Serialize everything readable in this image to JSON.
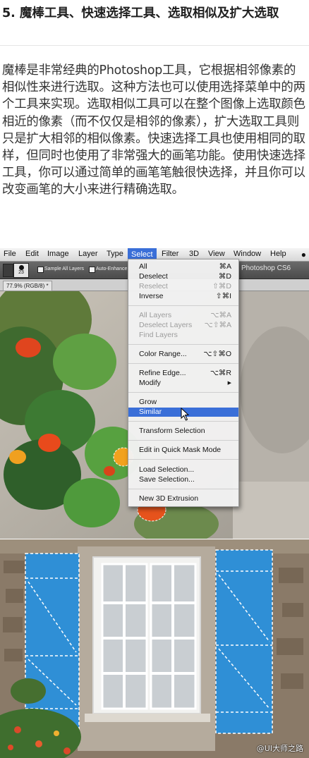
{
  "article": {
    "heading": "5. 魔棒工具、快速选择工具、选取相似及扩大选取",
    "paragraph": "魔棒是非常经典的Photoshop工具，它根据相邻像素的相似性来进行选取。这种方法也可以使用选择菜单中的两个工具来实现。选取相似工具可以在整个图像上选取颜色相近的像素（而不仅仅是相邻的像素），扩大选取工具则只是扩大相邻的相似像素。快速选择工具也使用相同的取样，但同时也使用了非常强大的画笔功能。使用快速选择工具，你可以通过简单的画笔笔触很快选择，并且你可以改变画笔的大小来进行精确选取。"
  },
  "photoshop": {
    "menubar": [
      "File",
      "Edit",
      "Image",
      "Layer",
      "Type",
      "Select",
      "Filter",
      "3D",
      "View",
      "Window",
      "Help"
    ],
    "active_menu": "Select",
    "apple_icon": "apple-icon",
    "options_bar": {
      "brush_size": "23",
      "sample_all_layers": "Sample All Layers",
      "auto_enhance": "Auto-Enhance",
      "app_title": "Photoshop CS6"
    },
    "document_tab": "77.9% (RGB/8) *",
    "select_menu": [
      {
        "label": "All",
        "shortcut": "⌘A",
        "enabled": true,
        "highlighted": false
      },
      {
        "label": "Deselect",
        "shortcut": "⌘D",
        "enabled": true,
        "highlighted": false
      },
      {
        "label": "Reselect",
        "shortcut": "⇧⌘D",
        "enabled": false,
        "highlighted": false
      },
      {
        "label": "Inverse",
        "shortcut": "⇧⌘I",
        "enabled": true,
        "highlighted": false
      },
      {
        "label": "All Layers",
        "shortcut": "⌥⌘A",
        "enabled": false,
        "highlighted": false
      },
      {
        "label": "Deselect Layers",
        "shortcut": "⌥⇧⌘A",
        "enabled": false,
        "highlighted": false
      },
      {
        "label": "Find Layers",
        "shortcut": "",
        "enabled": false,
        "highlighted": false
      },
      {
        "label": "Color Range...",
        "shortcut": "⌥⇧⌘O",
        "enabled": true,
        "highlighted": false
      },
      {
        "label": "Refine Edge...",
        "shortcut": "⌥⌘R",
        "enabled": true,
        "highlighted": false
      },
      {
        "label": "Modify",
        "shortcut": "▶",
        "enabled": true,
        "highlighted": false
      },
      {
        "label": "Grow",
        "shortcut": "",
        "enabled": true,
        "highlighted": false
      },
      {
        "label": "Similar",
        "shortcut": "",
        "enabled": true,
        "highlighted": true
      },
      {
        "label": "Transform Selection",
        "shortcut": "",
        "enabled": true,
        "highlighted": false
      },
      {
        "label": "Edit in Quick Mask Mode",
        "shortcut": "",
        "enabled": true,
        "highlighted": false
      },
      {
        "label": "Load Selection...",
        "shortcut": "",
        "enabled": true,
        "highlighted": false
      },
      {
        "label": "Save Selection...",
        "shortcut": "",
        "enabled": true,
        "highlighted": false
      },
      {
        "label": "New 3D Extrusion",
        "shortcut": "",
        "enabled": true,
        "highlighted": false
      }
    ]
  },
  "watermark": "@UI大师之路",
  "colors": {
    "menu_highlight": "#3a6fd8",
    "shutter_blue": "#2f8fd6",
    "heading_text": "#1f1f1f"
  }
}
